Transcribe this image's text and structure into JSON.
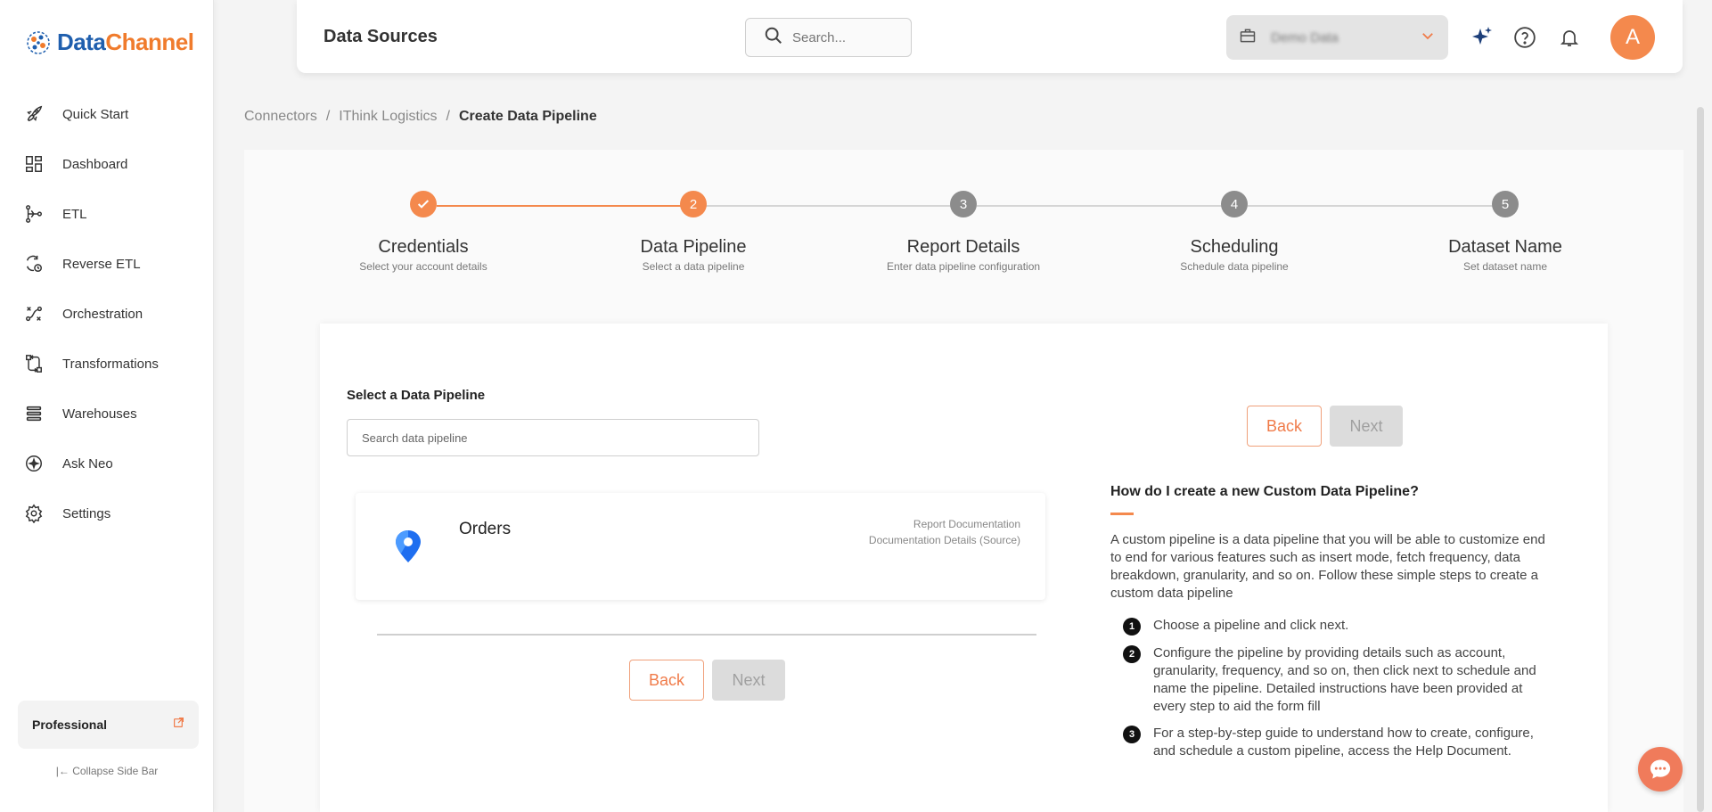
{
  "brand": {
    "name_part1": "Data",
    "name_part2": "Channel"
  },
  "sidebar": {
    "items": [
      {
        "label": "Quick Start",
        "icon": "rocket-icon"
      },
      {
        "label": "Dashboard",
        "icon": "dashboard-icon"
      },
      {
        "label": "ETL",
        "icon": "etl-icon"
      },
      {
        "label": "Reverse ETL",
        "icon": "reverse-etl-icon"
      },
      {
        "label": "Orchestration",
        "icon": "orchestration-icon"
      },
      {
        "label": "Transformations",
        "icon": "transformations-icon"
      },
      {
        "label": "Warehouses",
        "icon": "warehouses-icon"
      },
      {
        "label": "Ask Neo",
        "icon": "ask-neo-icon"
      },
      {
        "label": "Settings",
        "icon": "gear-icon"
      }
    ],
    "plan": "Professional",
    "collapse_label": "Collapse Side Bar"
  },
  "header": {
    "title": "Data Sources",
    "search_placeholder": "Search...",
    "workspace_name": "Demo Data",
    "avatar_letter": "A"
  },
  "breadcrumb": {
    "items": [
      "Connectors",
      "IThink Logistics"
    ],
    "current": "Create Data Pipeline"
  },
  "stepper": {
    "steps": [
      {
        "marker": "",
        "title": "Credentials",
        "subtitle": "Select your account details",
        "state": "done"
      },
      {
        "marker": "2",
        "title": "Data Pipeline",
        "subtitle": "Select a data pipeline",
        "state": "active"
      },
      {
        "marker": "3",
        "title": "Report Details",
        "subtitle": "Enter data pipeline configuration",
        "state": "pending"
      },
      {
        "marker": "4",
        "title": "Scheduling",
        "subtitle": "Schedule data pipeline",
        "state": "pending"
      },
      {
        "marker": "5",
        "title": "Dataset Name",
        "subtitle": "Set dataset name",
        "state": "pending"
      }
    ]
  },
  "pipeline_select": {
    "label": "Select a Data Pipeline",
    "search_placeholder": "Search data pipeline",
    "pipelines": [
      {
        "name": "Orders",
        "link_report_doc": "Report Documentation",
        "link_details": "Documentation Details (Source)"
      }
    ],
    "back_label": "Back",
    "next_label": "Next"
  },
  "help": {
    "title": "How do I create a new Custom Data Pipeline?",
    "description": "A custom pipeline is a data pipeline that you will be able to customize end to end for various features such as insert mode, fetch frequency, data breakdown, granularity, and so on. Follow these simple steps to create a custom data pipeline",
    "steps": [
      {
        "num": "1",
        "text": "Choose a pipeline and click next."
      },
      {
        "num": "2",
        "text": "Configure the pipeline by providing details such as account, granularity, frequency, and so on, then click next to schedule and name the pipeline. Detailed instructions have been provided at every step to aid the form fill"
      },
      {
        "num": "3",
        "text": "For a step-by-step guide to understand how to create, configure, and schedule a custom pipeline, access the Help Document."
      }
    ]
  },
  "colors": {
    "accent": "#f4894d",
    "brand_blue": "#1f5fae",
    "pending": "#8c8c8c"
  }
}
